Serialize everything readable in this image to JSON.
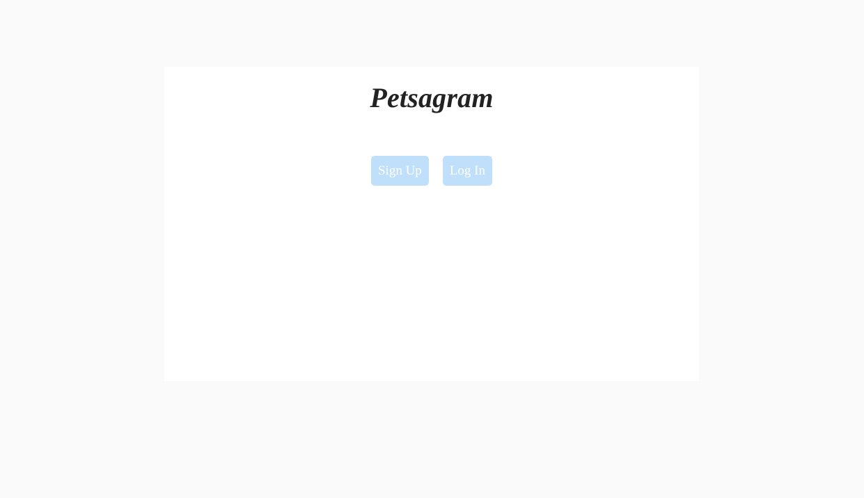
{
  "brand": {
    "title": "Petsagram"
  },
  "auth": {
    "signup_label": "Sign Up",
    "login_label": "Log In"
  },
  "colors": {
    "page_background": "#fafafa",
    "card_background": "#ffffff",
    "button_background": "#c0dffb",
    "button_text": "#ffffff",
    "title_text": "#222222"
  }
}
